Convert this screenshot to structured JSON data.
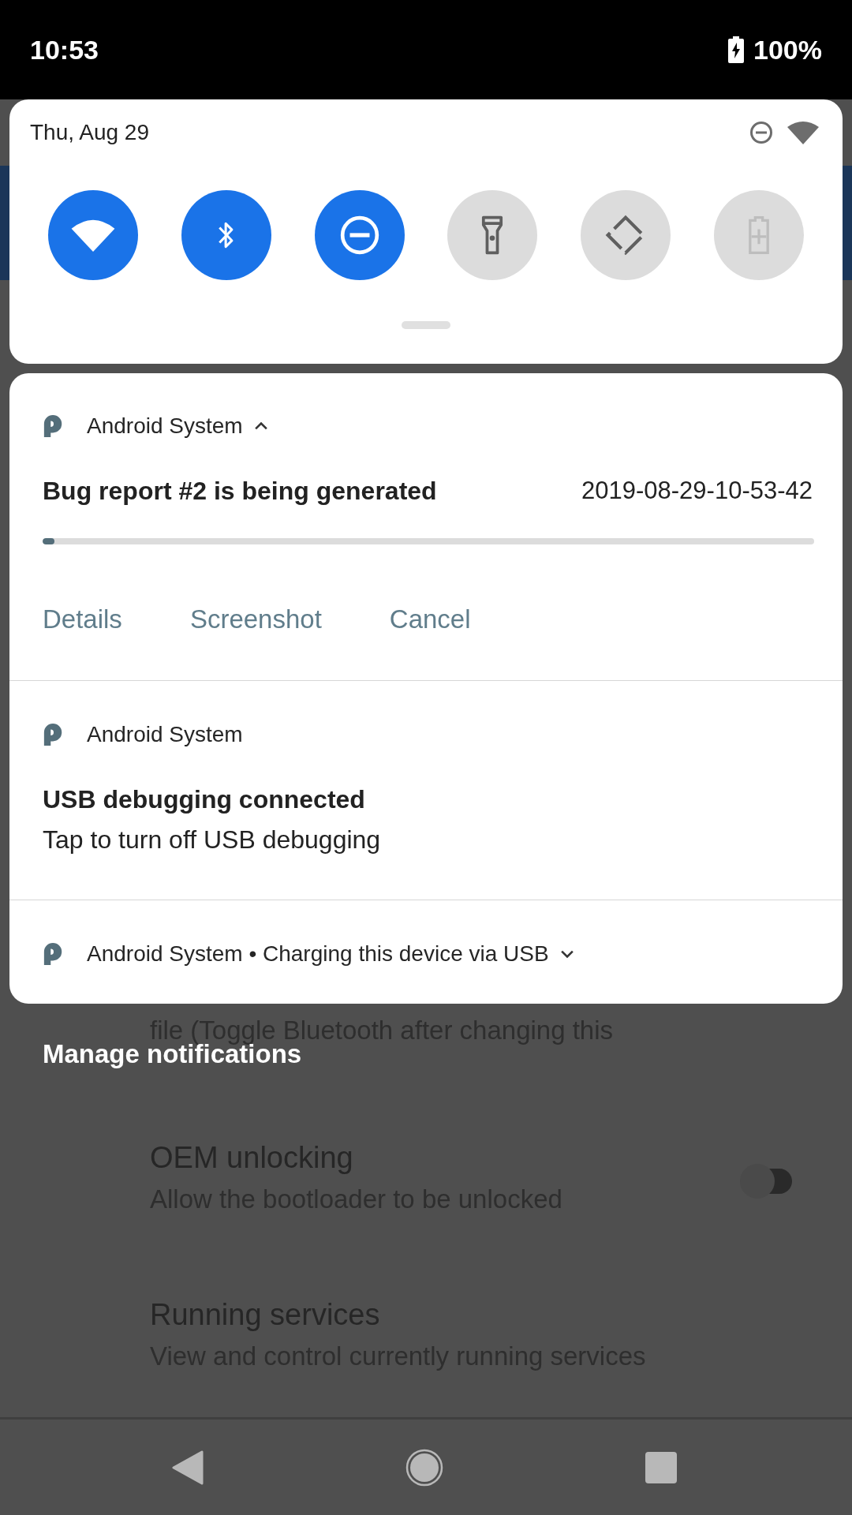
{
  "status_bar": {
    "time": "10:53",
    "battery": "100%"
  },
  "background_settings": {
    "items": [
      {
        "kind": "text",
        "text": "file (Toggle Bluetooth after changing this"
      },
      {
        "kind": "toggle",
        "title": "OEM unlocking",
        "subtitle": "Allow the bootloader to be unlocked",
        "on": false
      },
      {
        "kind": "plain",
        "title": "Running services",
        "subtitle": "View and control currently running services"
      }
    ]
  },
  "quick_settings": {
    "date": "Thu, Aug 29",
    "tiles": [
      {
        "kind": "wifi",
        "on": true,
        "disabled": false
      },
      {
        "kind": "bluetooth",
        "on": true,
        "disabled": false
      },
      {
        "kind": "dnd",
        "on": true,
        "disabled": false
      },
      {
        "kind": "flashlight",
        "on": false,
        "disabled": false
      },
      {
        "kind": "rotate",
        "on": false,
        "disabled": false
      },
      {
        "kind": "battery_saver",
        "on": false,
        "disabled": true
      }
    ]
  },
  "notifications": [
    {
      "kind": "progress",
      "app": "Android System",
      "expanded": true,
      "title": "Bug report #2 is being generated",
      "detail": "2019-08-29-10-53-42",
      "level": 0.015,
      "actions": [
        "Details",
        "Screenshot",
        "Cancel"
      ]
    },
    {
      "kind": "standard",
      "app": "Android System",
      "title": "USB debugging connected",
      "text": "Tap to turn off USB debugging"
    },
    {
      "kind": "collapsed",
      "app": "Android System",
      "separator": "•",
      "summary": "Charging this device via USB",
      "expanded": false
    }
  ],
  "manage_label": "Manage notifications"
}
